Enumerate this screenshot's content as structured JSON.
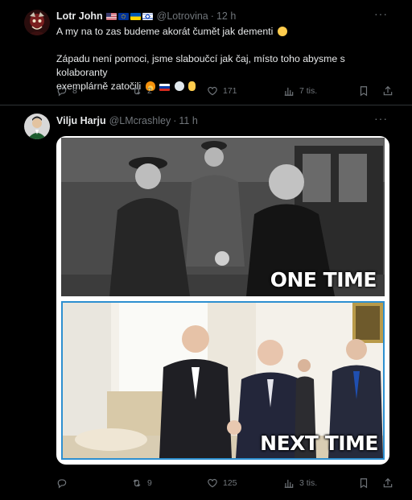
{
  "tweet1": {
    "author_name": "Lotr John",
    "handle": "@Lotrovina",
    "separator": "·",
    "time": "12 h",
    "text_line1": "A my na to zas budeme akorát čumět jak dementi",
    "text_line2": "Západu není pomoci, jsme slaboučcí jak čaj, místo toho abysme s kolaboranty",
    "text_line3": "exemplárně zatočili",
    "replies": "8",
    "reposts": "2",
    "likes": "171",
    "views": "7 tis."
  },
  "tweet2": {
    "author_name": "Vilju Harju",
    "handle": "@LMcrashley",
    "separator": "·",
    "time": "11 h",
    "image_top_caption": "ONE TIME",
    "image_bottom_caption": "NEXT TIME",
    "replies": "",
    "reposts": "9",
    "likes": "125",
    "views": "3 tis."
  },
  "icons": {
    "more": "more-horizontal-icon",
    "reply": "reply-icon",
    "repost": "repost-icon",
    "like": "heart-icon",
    "views": "analytics-icon",
    "bookmark": "bookmark-icon",
    "share": "share-icon"
  },
  "colors": {
    "background": "#000000",
    "text": "#e7e9ea",
    "muted": "#71767b",
    "divider": "#2f3336",
    "frame_blue": "#2d8fd0"
  }
}
